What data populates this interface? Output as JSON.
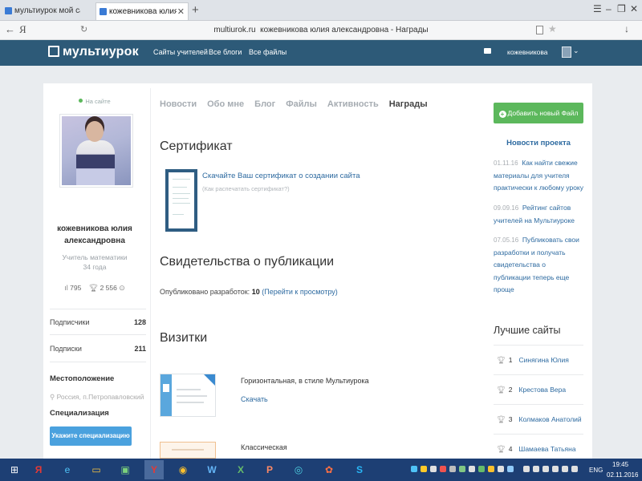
{
  "browser": {
    "tabs": [
      {
        "title": "мультиурок мой сайт вход"
      },
      {
        "title": "кожевникова юлия алек"
      }
    ],
    "url_host": "multiurok.ru",
    "url_title": "кожевникова юлия александровна - Награды",
    "logo_text": "Я",
    "icons": {
      "back": "back-arrow-icon",
      "reload": "reload-icon",
      "star": "star-icon",
      "download": "download-icon"
    }
  },
  "header": {
    "logo": "мультиурок",
    "nav": [
      "Сайты учителей",
      "Все блоги",
      "Все файлы"
    ],
    "username": "кожевникова",
    "brand_color": "#2d5a78"
  },
  "profile": {
    "status": "На сайте",
    "name_line1": "кожевникова юлия",
    "name_line2": "александровна",
    "role": "Учитель математики",
    "age": "34 года",
    "stat_views": "795",
    "stat_awards": "2 556",
    "subscribers_label": "Подписчики",
    "subscribers": "128",
    "subscriptions_label": "Подписки",
    "subscriptions": "211",
    "location_heading": "Местоположение",
    "location": "Россия, п.Петропавловский",
    "spec_heading": "Специализация",
    "spec_button": "Укажите специализацию"
  },
  "tabs": [
    {
      "label": "Новости",
      "active": false
    },
    {
      "label": "Обо мне",
      "active": false
    },
    {
      "label": "Блог",
      "active": false
    },
    {
      "label": "Файлы",
      "active": false
    },
    {
      "label": "Активность",
      "active": false
    },
    {
      "label": "Награды",
      "active": true
    }
  ],
  "certificate": {
    "heading": "Сертификат",
    "link": "Скачайте Ваш сертификат о создании сайта",
    "sub": "(Как распечатать сертификат?)"
  },
  "publications": {
    "heading": "Свидетельства о публикации",
    "text": "Опубликовано разработок:",
    "count": "10",
    "link": "(Перейти к просмотру)"
  },
  "cards": {
    "heading": "Визитки",
    "items": [
      {
        "title": "Горизонтальная, в стиле Мультиурока",
        "download": "Скачать"
      },
      {
        "title": "Классическая"
      }
    ]
  },
  "sidebar": {
    "add_button": "Добавить новый Файл",
    "news_heading": "Новости проекта",
    "news": [
      {
        "date": "01.11.16",
        "text": "Как найти свежие материалы для учителя практически к любому уроку"
      },
      {
        "date": "09.09.16",
        "text": "Рейтинг сайтов учителей на Мультиуроке"
      },
      {
        "date": "07.05.16",
        "text": "Публиковать свои разработки и получать свидетельства о публикации теперь еще проще"
      }
    ],
    "best_heading": "Лучшие сайты",
    "best": [
      {
        "rank": "1",
        "name": "Синягина Юлия"
      },
      {
        "rank": "2",
        "name": "Крестова Вера"
      },
      {
        "rank": "3",
        "name": "Колмаков Анатолий"
      },
      {
        "rank": "4",
        "name": "Шамаева Татьяна"
      }
    ]
  },
  "taskbar": {
    "lang": "ENG",
    "time": "19:45",
    "date": "02.11.2016"
  }
}
